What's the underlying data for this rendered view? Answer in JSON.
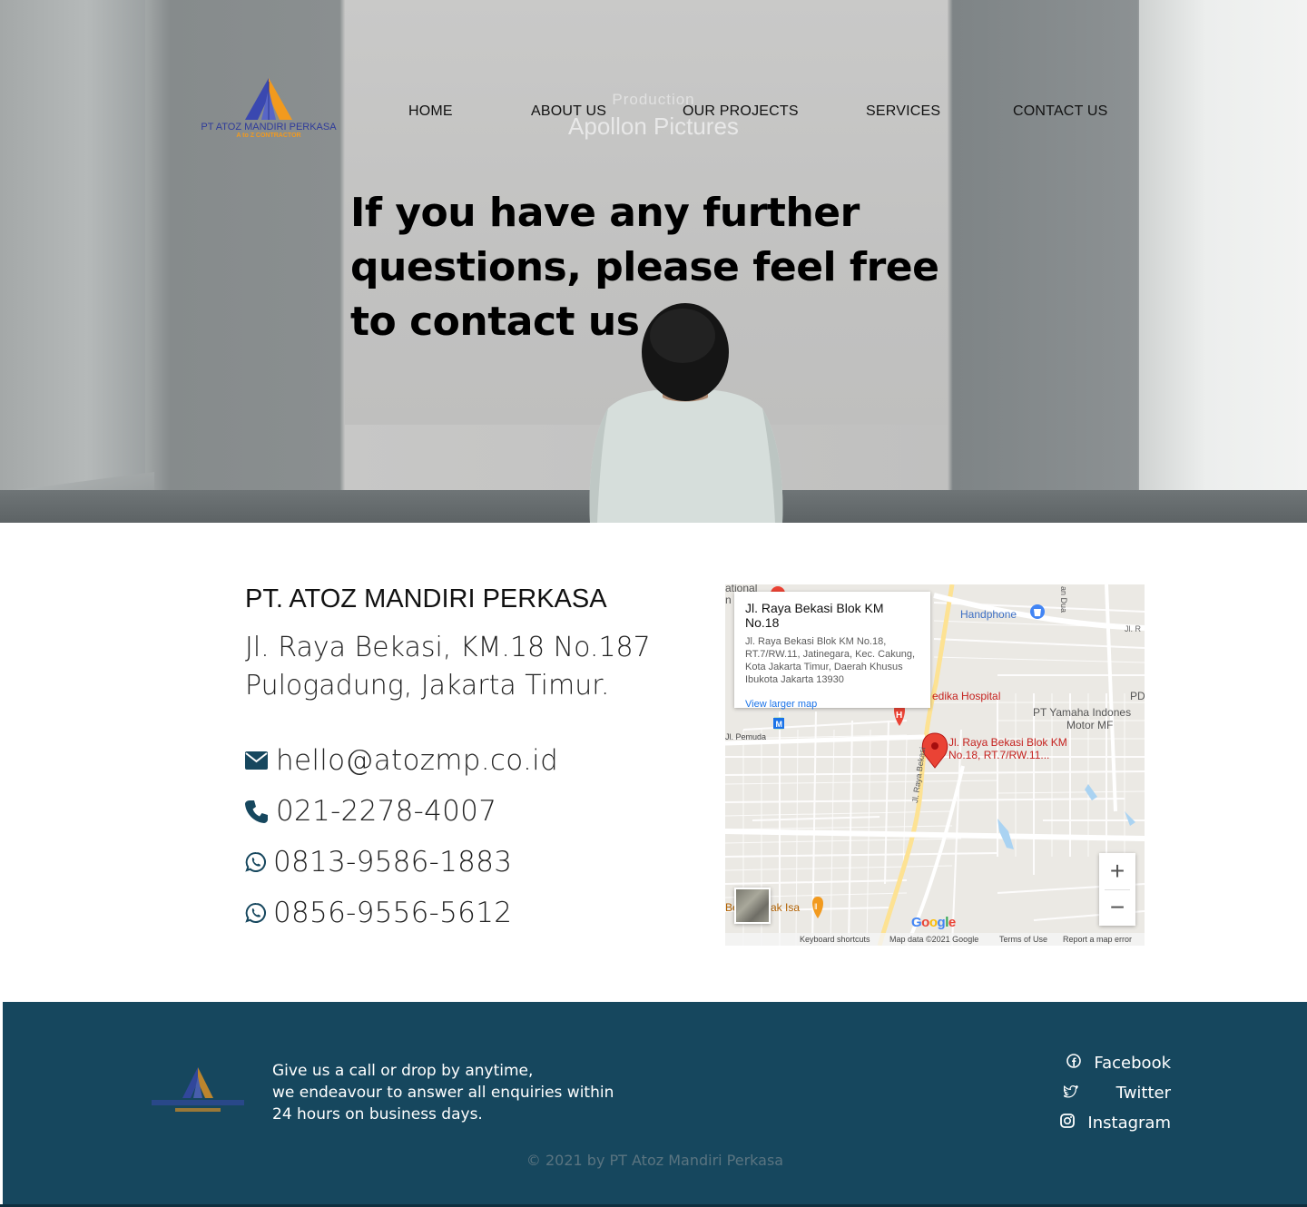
{
  "logo": {
    "name": "PT ATOZ MANDIRI PERKASA",
    "tagline": "A to Z CONTRACTOR"
  },
  "nav": {
    "items": [
      {
        "label": "HOME"
      },
      {
        "label": "ABOUT US"
      },
      {
        "label": "OUR PROJECTS"
      },
      {
        "label": "SERVICES"
      },
      {
        "label": "CONTACT US"
      }
    ]
  },
  "hero": {
    "title": "If you have any further questions, please feel free to contact us",
    "projection_line1": "Production",
    "projection_line2": "Apollon Pictures"
  },
  "contact": {
    "company": "PT. ATOZ MANDIRI PERKASA",
    "address_line1": "Jl. Raya Bekasi, KM.18 No.187",
    "address_line2": "Pulogadung, Jakarta Timur.",
    "email": "hello@atozmp.co.id",
    "phone": "021-2278-4007",
    "whatsapp1": "0813-9586-1883",
    "whatsapp2": "0856-9556-5612",
    "icons": [
      "envelope-icon",
      "phone-icon",
      "whatsapp-icon",
      "whatsapp-icon"
    ]
  },
  "map": {
    "card_title": "Jl. Raya Bekasi Blok KM No.18",
    "card_address": "Jl. Raya Bekasi Blok KM No.18, RT.7/RW.11, Jatinegara, Kec. Cakung, Kota Jakarta Timur, Daerah Khusus Ibukota Jakarta 13930",
    "card_link": "View larger map",
    "labels": {
      "national": "ational",
      "national2": "n",
      "handphone": "Handphone",
      "jlr": "Jl. R",
      "hospital": "edika Hospital",
      "yamaha1": "PT Yamaha Indones",
      "yamaha2": "Motor MF",
      "pd": "PD",
      "pemuda": "Jl. Pemuda",
      "pin1": "Jl. Raya Bekasi Blok KM",
      "pin2": "No.18, RT.7/RW.11...",
      "raya_bekasi": "Jl. Raya Bekasi",
      "dua": "an Dua",
      "isa": "ak Isa",
      "be": "Be",
      "google": "Google"
    },
    "zoom_in": "+",
    "zoom_out": "−",
    "attribution": {
      "shortcuts": "Keyboard shortcuts",
      "data": "Map data ©2021 Google",
      "terms": "Terms of Use",
      "report": "Report a map error"
    },
    "colors": {
      "pin": "#ea4335",
      "poi_blue": "#4285f4",
      "link": "#1a73e8"
    }
  },
  "footer": {
    "text_line1": "Give us a call or drop by anytime,",
    "text_line2": "we endeavour to answer all enquiries within",
    "text_line3": "24 hours on business days.",
    "social": [
      {
        "label": "Facebook",
        "icon": "facebook-icon"
      },
      {
        "label": "Twitter",
        "icon": "twitter-icon"
      },
      {
        "label": "Instagram",
        "icon": "instagram-icon"
      }
    ],
    "copyright": "© 2021 by PT Atoz Mandiri Perkasa",
    "colors": {
      "background": "#16475e"
    }
  }
}
